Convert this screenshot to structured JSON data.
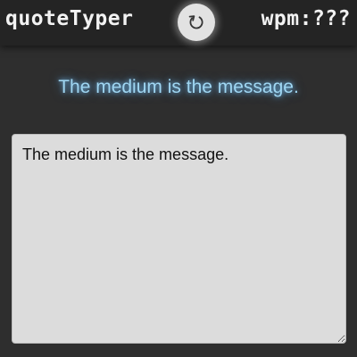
{
  "header": {
    "app_title": "quoteTyper",
    "wpm_label": "wpm:???",
    "reload_icon": "reload-icon"
  },
  "quote": {
    "text": "The medium is the message."
  },
  "typing_area": {
    "value": "The medium is the message."
  },
  "colors": {
    "background": "#2e2e2e",
    "header_background": "#242424",
    "quote_glow": "#9fd6f2",
    "text_area_background": "#dcdcdc"
  }
}
